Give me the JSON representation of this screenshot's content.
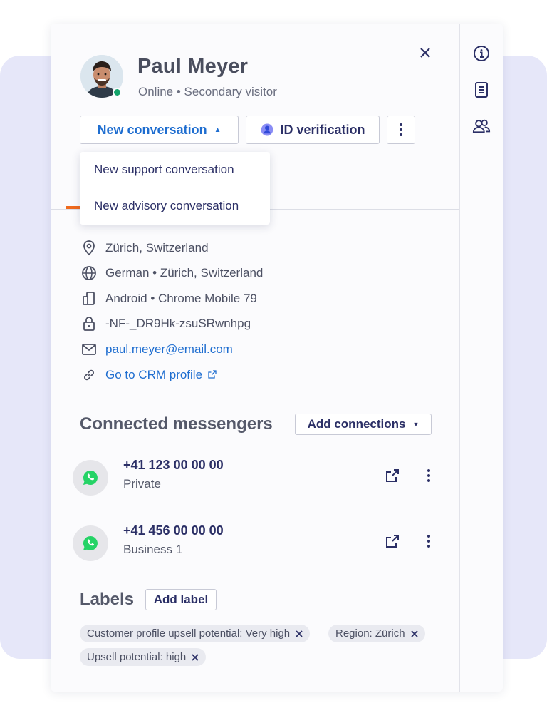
{
  "profile": {
    "name": "Paul Meyer",
    "status": "Online • Secondary visitor"
  },
  "actions": {
    "new_conversation": "New conversation",
    "id_verification": "ID verification"
  },
  "dropdown": {
    "items": [
      "New support conversation",
      "New advisory conversation"
    ]
  },
  "info": {
    "location": "Zürich, Switzerland",
    "language": "German • Zürich, Switzerland",
    "device": "Android • Chrome Mobile 79",
    "visitor_id": "-NF-_DR9Hk-zsuSRwnhpg",
    "email": "paul.meyer@email.com",
    "crm_link": "Go to CRM profile"
  },
  "messengers": {
    "title": "Connected messengers",
    "add_button": "Add connections",
    "items": [
      {
        "phone": "+41 123 00 00 00",
        "type": "Private"
      },
      {
        "phone": "+41 456 00 00 00",
        "type": "Business 1"
      }
    ]
  },
  "labels": {
    "title": "Labels",
    "add_button": "Add label",
    "chips": [
      "Customer profile upsell potential: Very high",
      "Region: Zürich",
      "Upsell potential: high"
    ]
  },
  "colors": {
    "accent": "#1f6ed0",
    "navy": "#2b2f66",
    "online": "#13a36a",
    "tab_indicator": "#f06a1d",
    "whatsapp": "#25d366"
  },
  "icons": {
    "rail": [
      "info-icon",
      "notes-icon",
      "users-icon"
    ],
    "info_rows": [
      "location-pin-icon",
      "globe-icon",
      "device-icon",
      "lock-icon",
      "mail-icon",
      "link-icon"
    ]
  }
}
